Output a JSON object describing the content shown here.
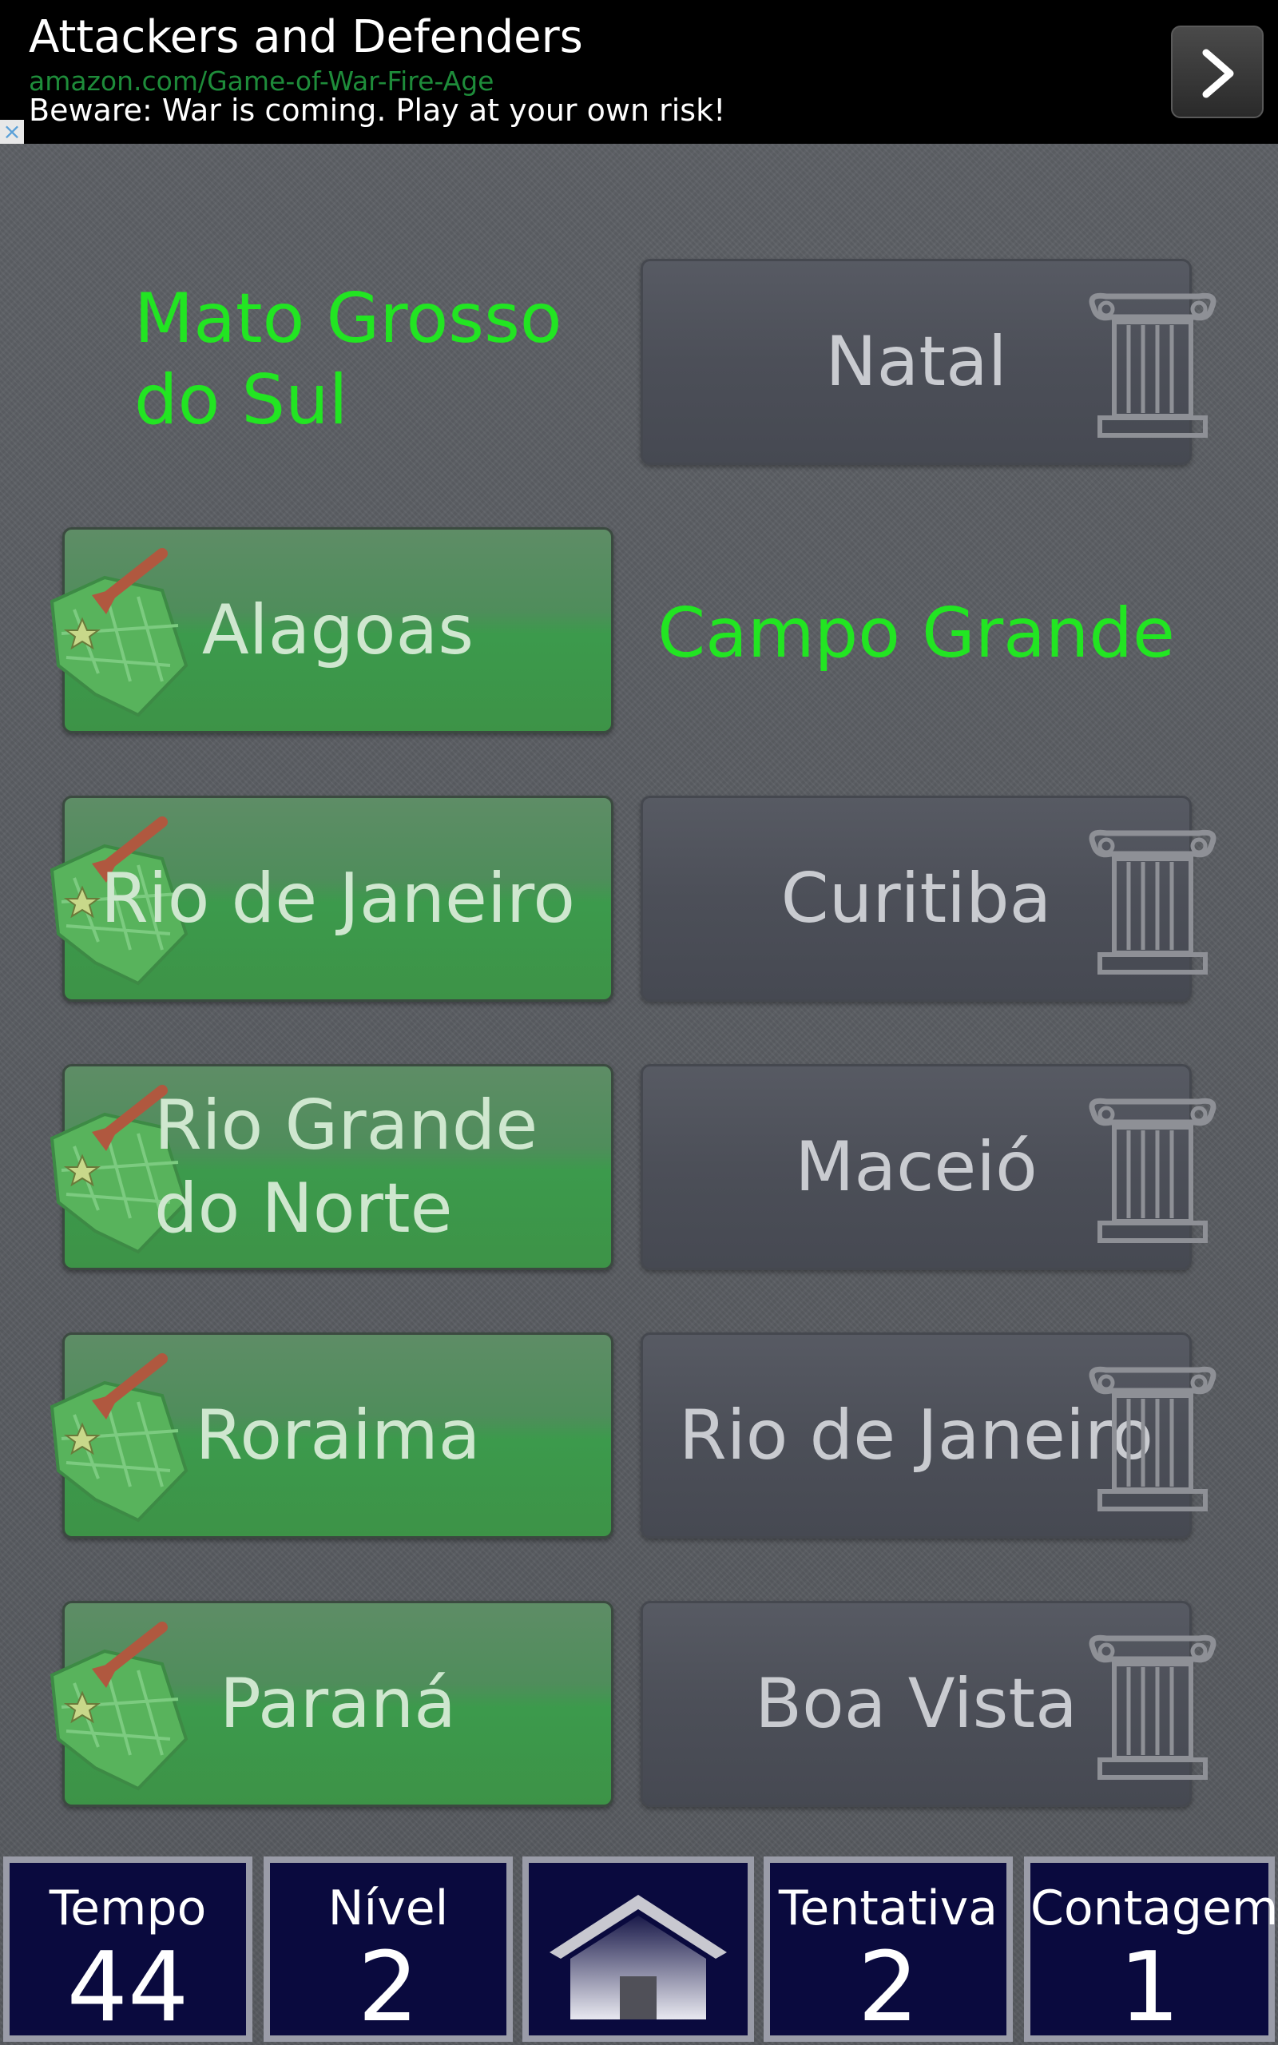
{
  "ad": {
    "title": "Attackers and Defenders",
    "url": "amazon.com/Game-of-War-Fire-Age",
    "description": "Beware: War is coming. Play at your own risk!",
    "close_icon": "×",
    "next_icon": "chevron-right-icon"
  },
  "rows": [
    {
      "left": {
        "text": "Mato Grosso do Sul",
        "state": "matched-text"
      },
      "right": {
        "text": "Natal",
        "state": "button"
      }
    },
    {
      "left": {
        "text": "Alagoas",
        "state": "button"
      },
      "right": {
        "text": "Campo Grande",
        "state": "matched-text"
      }
    },
    {
      "left": {
        "text": "Rio de Janeiro",
        "state": "button"
      },
      "right": {
        "text": "Curitiba",
        "state": "button"
      }
    },
    {
      "left": {
        "text": "Rio Grande do Norte",
        "state": "button"
      },
      "right": {
        "text": "Maceió",
        "state": "button"
      }
    },
    {
      "left": {
        "text": "Roraima",
        "state": "button"
      },
      "right": {
        "text": "Rio de Janeiro",
        "state": "button"
      }
    },
    {
      "left": {
        "text": "Paraná",
        "state": "button"
      },
      "right": {
        "text": "Boa Vista",
        "state": "button"
      }
    }
  ],
  "stats": {
    "time_label": "Tempo",
    "time_value": "44",
    "level_label": "Nível",
    "level_value": "2",
    "attempt_label": "Tentativa",
    "attempt_value": "2",
    "count_label": "Contagem",
    "count_value": "1"
  },
  "colors": {
    "matched_text": "#22e522",
    "state_tile": "#3d9347",
    "capital_tile": "#4c4f58",
    "stat_bg": "#0a0a3e"
  },
  "icons": {
    "state": "map-icon",
    "capital": "column-icon",
    "home": "home-icon"
  }
}
